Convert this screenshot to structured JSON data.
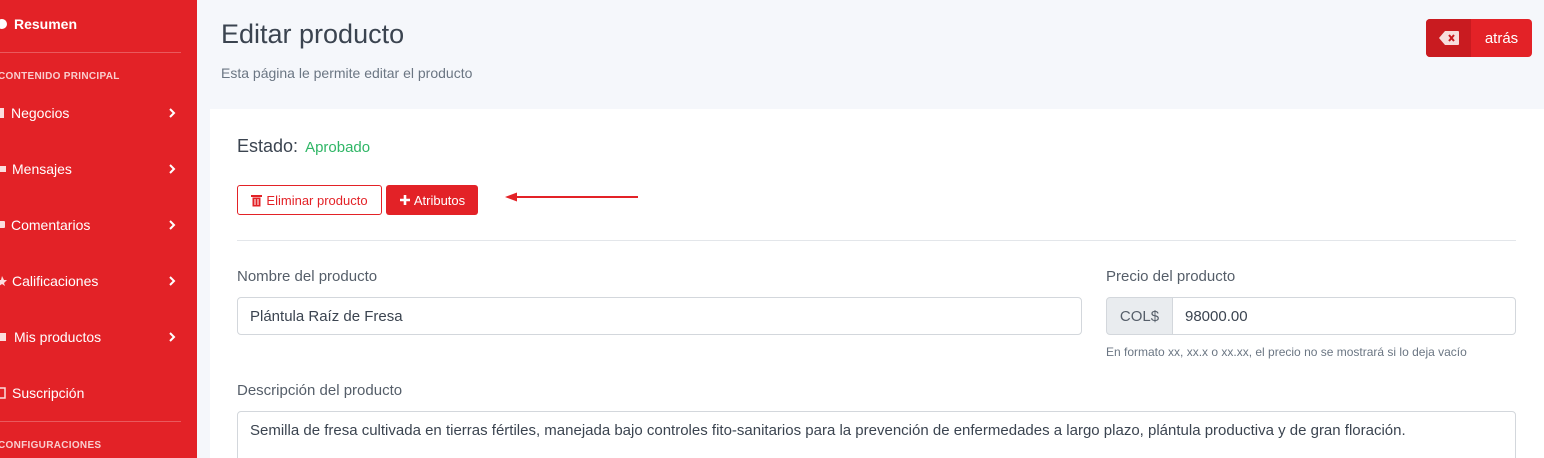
{
  "sidebar": {
    "resumen": "Resumen",
    "section_main": "CONTENIDO PRINCIPAL",
    "items": [
      {
        "label": "Negocios",
        "icon": "building-icon"
      },
      {
        "label": "Mensajes",
        "icon": "envelope-icon"
      },
      {
        "label": "Comentarios",
        "icon": "comment-icon"
      },
      {
        "label": "Calificaciones",
        "icon": "star-icon"
      },
      {
        "label": "Mis productos",
        "icon": "box-icon"
      },
      {
        "label": "Suscripción",
        "icon": "card-icon"
      }
    ],
    "section_config": "CONFIGURACIONES"
  },
  "header": {
    "title": "Editar producto",
    "subtitle": "Esta página le permite editar el producto",
    "back_label": "atrás"
  },
  "card": {
    "estado_label": "Estado:",
    "estado_value": "Aprobado",
    "delete_label": "Eliminar producto",
    "attributes_label": "Atributos",
    "name_label": "Nombre del producto",
    "name_value": "Plántula Raíz de Fresa",
    "price_label": "Precio del producto",
    "currency": "COL$",
    "price_value": "98000.00",
    "price_help": "En formato xx, xx.x o xx.xx, el precio no se mostrará si lo deja vacío",
    "desc_label": "Descripción del producto",
    "desc_value": "Semilla de fresa cultivada en tierras fértiles, manejada bajo controles fito-sanitarios para la prevención de enfermedades a largo plazo, plántula productiva y de gran floración."
  },
  "colors": {
    "brand_red": "#e32227",
    "status_green": "#2fb666"
  }
}
